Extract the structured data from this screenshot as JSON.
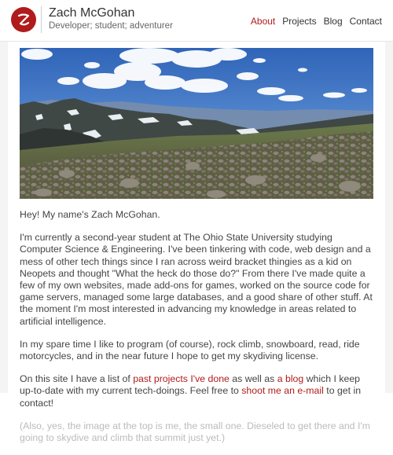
{
  "header": {
    "logo_text": "Z",
    "name": "Zach McGohan",
    "tagline": "Developer; student; adventurer",
    "nav": [
      {
        "label": "About",
        "active": true
      },
      {
        "label": "Projects",
        "active": false
      },
      {
        "label": "Blog",
        "active": false
      },
      {
        "label": "Contact",
        "active": false
      }
    ]
  },
  "colors": {
    "accent": "#b01b1b",
    "text": "#444444"
  },
  "hero_image": {
    "description": "mountain panorama"
  },
  "intro": "Hey! My name's Zach McGohan.",
  "para1": "I'm currently a second-year student at The Ohio State University studying Computer Science & Engineering. I've been tinkering with code, web design and a mess of other tech things since I ran across weird bracket thingies as a kid on Neopets and thought \"What the heck do those do?\" From there I've made quite a few of my own websites, made add-ons for games, worked on the source code for game servers, managed some large databases, and a good share of other stuff. At the moment I'm most interested in advancing my knowledge in areas related to artificial intelligence.",
  "para2": "In my spare time I like to program (of course), rock climb, snowboard, read, ride motorcycles, and in the near future I hope to get my skydiving license.",
  "para3": {
    "t1": "On this site I have a list of ",
    "link1": "past projects I've done",
    "t2": " as well as ",
    "link2": "a blog",
    "t3": " which I keep up-to-date with my current tech-doings. Feel free to ",
    "link3": "shoot me an e-mail",
    "t4": " to get in contact!"
  },
  "para4_partial": "(Also, yes, the image at the top is me, the small one. Dieseled to get there and I'm going to skydive and climb that summit just yet.)"
}
